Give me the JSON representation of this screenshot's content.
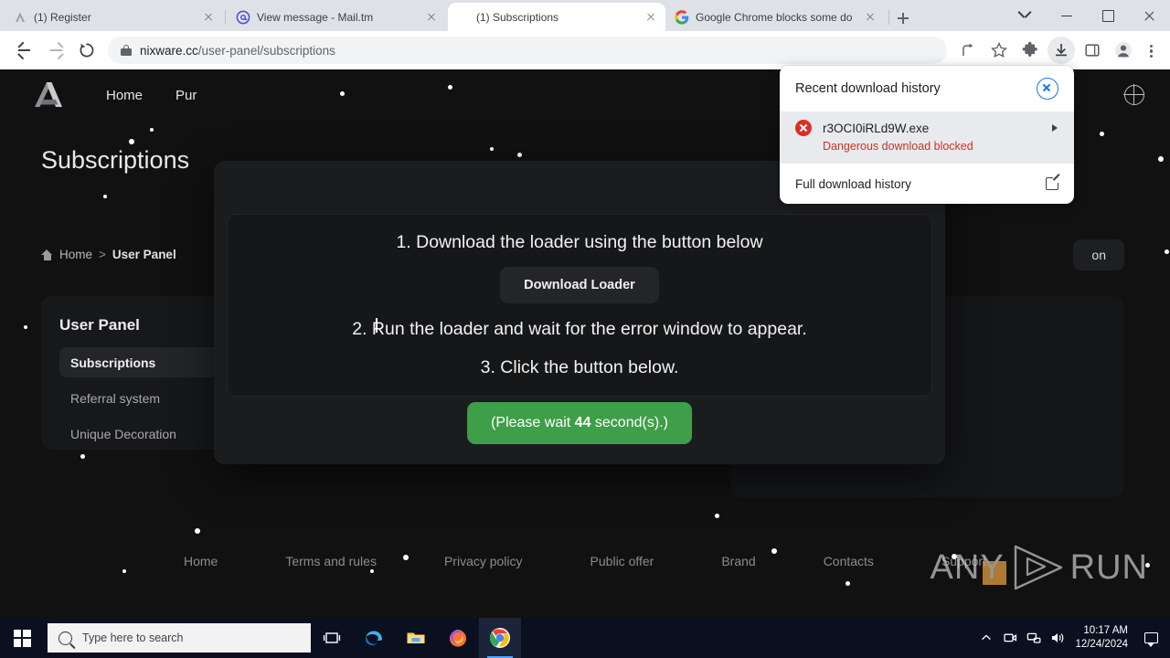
{
  "browser": {
    "tabs": [
      {
        "title": "(1) Register",
        "favicon": "nixware-logo-icon",
        "active": false
      },
      {
        "title": "View message - Mail.tm",
        "favicon": "mail-at-icon",
        "active": false
      },
      {
        "title": "(1) Subscriptions",
        "favicon": "",
        "active": true
      },
      {
        "title": "Google Chrome blocks some do",
        "favicon": "google-icon",
        "active": false
      }
    ],
    "new_tab_label": "+",
    "window_controls": {
      "chevron": "v",
      "minimize": "—",
      "maximize": "□",
      "close": "×"
    },
    "address": {
      "url_host": "nixware.cc",
      "url_path": "/user-panel/subscriptions",
      "lock": "secure"
    },
    "toolbar_icons": [
      "share-icon",
      "bookmark-star-icon",
      "extensions-puzzle-icon",
      "download-icon",
      "side-panel-icon",
      "profile-avatar-icon",
      "chrome-menu-icon"
    ]
  },
  "download_popup": {
    "title": "Recent download history",
    "close_label": "×",
    "item": {
      "filename": "r3OCI0iRLd9W.exe",
      "status": "Dangerous download blocked",
      "more_label": "▸"
    },
    "footer_label": "Full download history"
  },
  "site": {
    "nav": {
      "logo": "nixware-logo-icon",
      "links": [
        "Home",
        "Pur"
      ],
      "globe": "language-globe-icon"
    },
    "page_title": "Subscriptions",
    "breadcrumb": {
      "home_icon": "home-icon",
      "items": [
        "Home",
        "User Panel"
      ],
      "separator": ">"
    },
    "sidebar": {
      "heading": "User Panel",
      "items": [
        {
          "label": "Subscriptions",
          "active": true
        },
        {
          "label": "Referral system",
          "active": false
        },
        {
          "label": "Unique Decoration",
          "active": false
        }
      ]
    },
    "buy_button_label": "on",
    "footer_links": [
      "Home",
      "Terms and rules",
      "Privacy policy",
      "Public offer",
      "Brand",
      "Contacts",
      "Support"
    ],
    "watermark": {
      "left": "ANY",
      "right": "RUN",
      "play": "play-triangle-icon"
    }
  },
  "modal": {
    "step1": "1. Download the loader using the button below",
    "download_button": "Download Loader",
    "step2": "2. Run the loader and wait for the error window to appear.",
    "step3": "3. Click the button below.",
    "wait_button": {
      "prefix": "(Please wait ",
      "seconds": "44",
      "suffix": " second(s).)"
    },
    "accent_green": "#3f9e49"
  },
  "taskbar": {
    "start": "windows-start-icon",
    "search_placeholder": "Type here to search",
    "icons": [
      "task-view-icon",
      "edge-icon",
      "file-explorer-icon",
      "firefox-icon",
      "chrome-icon"
    ],
    "tray": [
      "chevron-up-icon",
      "webcam-icon",
      "network-icon",
      "volume-icon"
    ],
    "time": "10:17 AM",
    "date": "12/24/2024",
    "notifications": "notification-center-icon"
  }
}
